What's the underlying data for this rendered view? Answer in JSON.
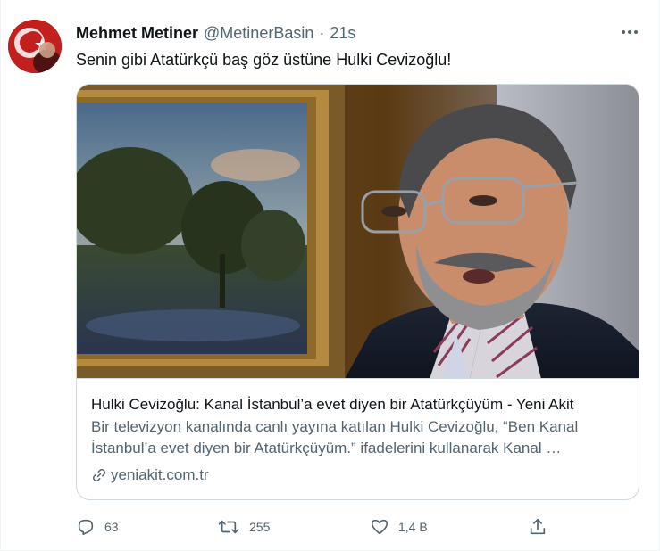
{
  "tweet": {
    "author_name": "Mehmet Metiner",
    "author_handle": "@MetinerBasin",
    "separator": "·",
    "time": "21s",
    "text": "Senin gibi Atatürkçü baş göz üstüne Hulki Cevizoğlu!"
  },
  "card": {
    "title": "Hulki Cevizoğlu: Kanal İstanbul’a evet diyen bir Atatürkçüyüm - Yeni Akit",
    "description": "Bir televizyon kanalında canlı yayına katılan Hulki Cevizoğlu, “Ben Kanal İstanbul’a evet diyen bir Atatürkçüyüm.” ifadelerini kullanarak Kanal …",
    "domain": "yeniakit.com.tr"
  },
  "actions": {
    "reply_count": "63",
    "retweet_count": "255",
    "like_count": "1,4 B"
  },
  "icons": {
    "avatar": "avatar-image",
    "more": "more-horizontal-icon",
    "link": "link-icon",
    "reply": "reply-icon",
    "retweet": "retweet-icon",
    "like": "heart-icon",
    "share": "share-icon"
  },
  "colors": {
    "text_primary": "#0f1419",
    "text_secondary": "#536471",
    "border": "#cfd9de"
  }
}
